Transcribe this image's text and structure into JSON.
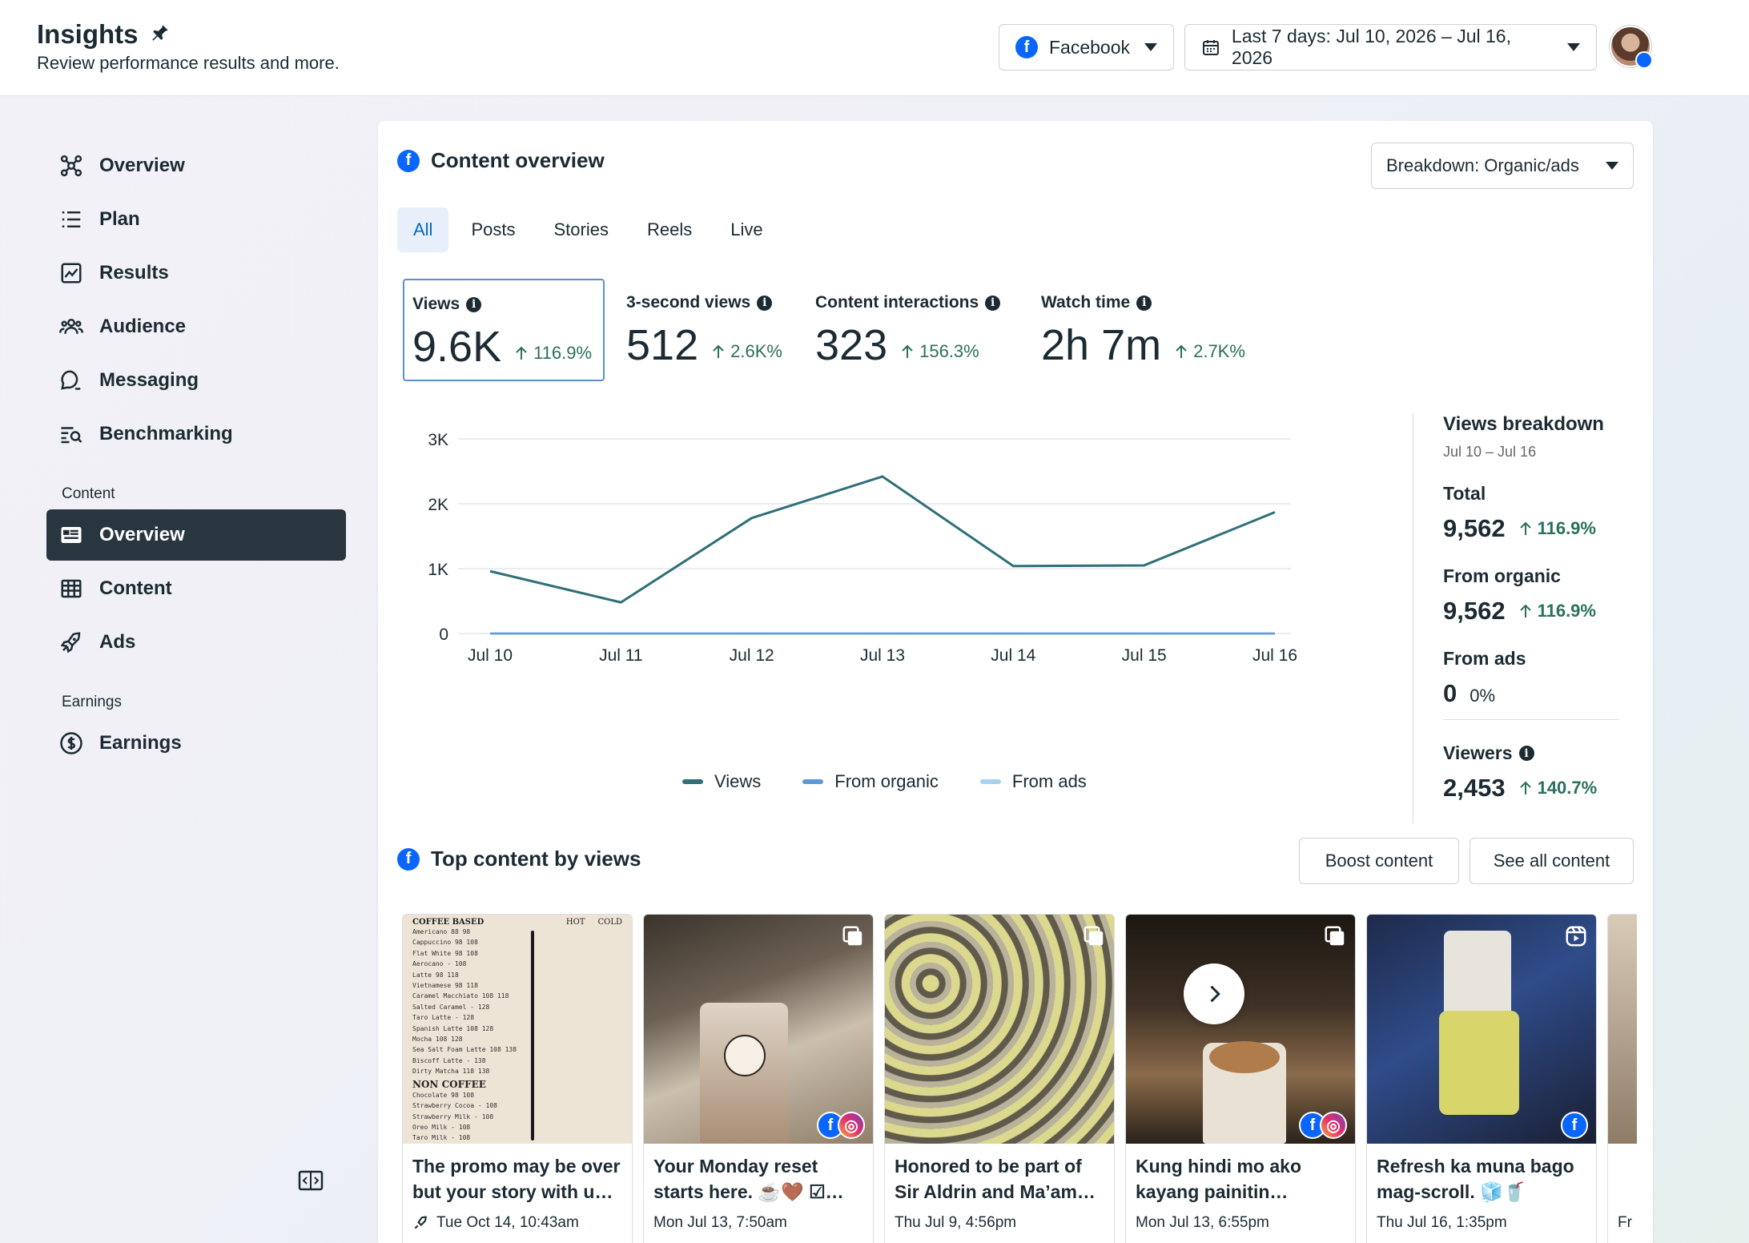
{
  "header": {
    "title": "Insights",
    "subtitle": "Review performance results and more.",
    "platform": "Facebook",
    "date_range": "Last 7 days: Jul 10, 2026 – Jul 16, 2026"
  },
  "sidebar": {
    "items": [
      {
        "label": "Overview",
        "icon": "overview-icon"
      },
      {
        "label": "Plan",
        "icon": "list-icon"
      },
      {
        "label": "Results",
        "icon": "chart-icon"
      },
      {
        "label": "Audience",
        "icon": "people-icon"
      },
      {
        "label": "Messaging",
        "icon": "chat-icon"
      },
      {
        "label": "Benchmarking",
        "icon": "benchmark-icon"
      }
    ],
    "content_section": "Content",
    "content_items": [
      {
        "label": "Overview",
        "icon": "card-icon",
        "active": true
      },
      {
        "label": "Content",
        "icon": "table-icon"
      },
      {
        "label": "Ads",
        "icon": "rocket-icon"
      }
    ],
    "earnings_section": "Earnings",
    "earnings_items": [
      {
        "label": "Earnings",
        "icon": "dollar-icon"
      }
    ]
  },
  "content_overview": {
    "title": "Content overview",
    "breakdown": "Breakdown: Organic/ads",
    "tabs": [
      "All",
      "Posts",
      "Stories",
      "Reels",
      "Live"
    ],
    "active_tab": "All",
    "metrics": [
      {
        "label": "Views",
        "value": "9.6K",
        "delta": "116.9%"
      },
      {
        "label": "3-second views",
        "value": "512",
        "delta": "2.6K%"
      },
      {
        "label": "Content interactions",
        "value": "323",
        "delta": "156.3%"
      },
      {
        "label": "Watch time",
        "value": "2h 7m",
        "delta": "2.7K%"
      }
    ]
  },
  "chart_data": {
    "type": "line",
    "x": [
      "Jul 10",
      "Jul 11",
      "Jul 12",
      "Jul 13",
      "Jul 14",
      "Jul 15",
      "Jul 16"
    ],
    "y_ticks": [
      "0",
      "1K",
      "2K",
      "3K"
    ],
    "ylim": [
      0,
      3000
    ],
    "grid": true,
    "legend_position": "bottom",
    "series": [
      {
        "name": "Views",
        "color": "#2f6f77",
        "values": [
          960,
          480,
          1780,
          2420,
          1040,
          1050,
          1870
        ]
      },
      {
        "name": "From organic",
        "color": "#5b9bd5",
        "values": [
          0,
          0,
          0,
          0,
          0,
          0,
          0
        ]
      },
      {
        "name": "From ads",
        "color": "#a8d3ee",
        "values": [
          0,
          0,
          0,
          0,
          0,
          0,
          0
        ]
      }
    ]
  },
  "views_breakdown": {
    "title": "Views breakdown",
    "range": "Jul 10 – Jul 16",
    "total_label": "Total",
    "total_value": "9,562",
    "total_delta": "116.9%",
    "organic_label": "From organic",
    "organic_value": "9,562",
    "organic_delta": "116.9%",
    "ads_label": "From ads",
    "ads_value": "0",
    "ads_delta": "0%",
    "viewers_label": "Viewers",
    "viewers_value": "2,453",
    "viewers_delta": "140.7%"
  },
  "top_content": {
    "title": "Top content by views",
    "boost_label": "Boost content",
    "see_all_label": "See all content",
    "posts": [
      {
        "title": "The promo may be over but your story with u…",
        "date": "Tue Oct 14, 10:43am",
        "type": "boosted"
      },
      {
        "title": "Your Monday reset starts here. ☕🤎 ☑…",
        "date": "Mon Jul 13, 7:50am",
        "type": "photo"
      },
      {
        "title": "Honored to be part of Sir Aldrin and Ma’am…",
        "date": "Thu Jul 9, 4:56pm",
        "type": "album"
      },
      {
        "title": "Kung hindi mo ako kayang painitin…",
        "date": "Mon Jul 13, 6:55pm",
        "type": "photo"
      },
      {
        "title": "Refresh ka muna bago mag-scroll. 🧊🥤",
        "date": "Thu Jul 16, 1:35pm",
        "type": "reel"
      },
      {
        "title": "",
        "date": "Fr",
        "type": "photo"
      }
    ],
    "menu": {
      "heading": "COFFEE BASED",
      "col_hot": "HOT",
      "col_cold": "COLD",
      "items": [
        "Americano 88 98",
        "Cappuccino 98 108",
        "Flat White 98 108",
        "Aerocano - 108",
        "Latte 98 118",
        "Vietnamese 98 118",
        "Caramel Macchiato 108 118",
        "Salted Caramel - 128",
        "Taro Latte - 128",
        "Spanish Latte 108 128",
        "Mocha 108 128",
        "Sea Salt Foam Latte 108 138",
        "Biscoff Latte - 138",
        "Dirty Matcha 118 138"
      ],
      "heading2": "NON COFFEE",
      "items2": [
        "Chocolate 98 108",
        "Strawberry Cocoa - 108",
        "Strawberry Milk - 108",
        "Oreo Milk - 108",
        "Taro Milk - 108"
      ]
    }
  }
}
